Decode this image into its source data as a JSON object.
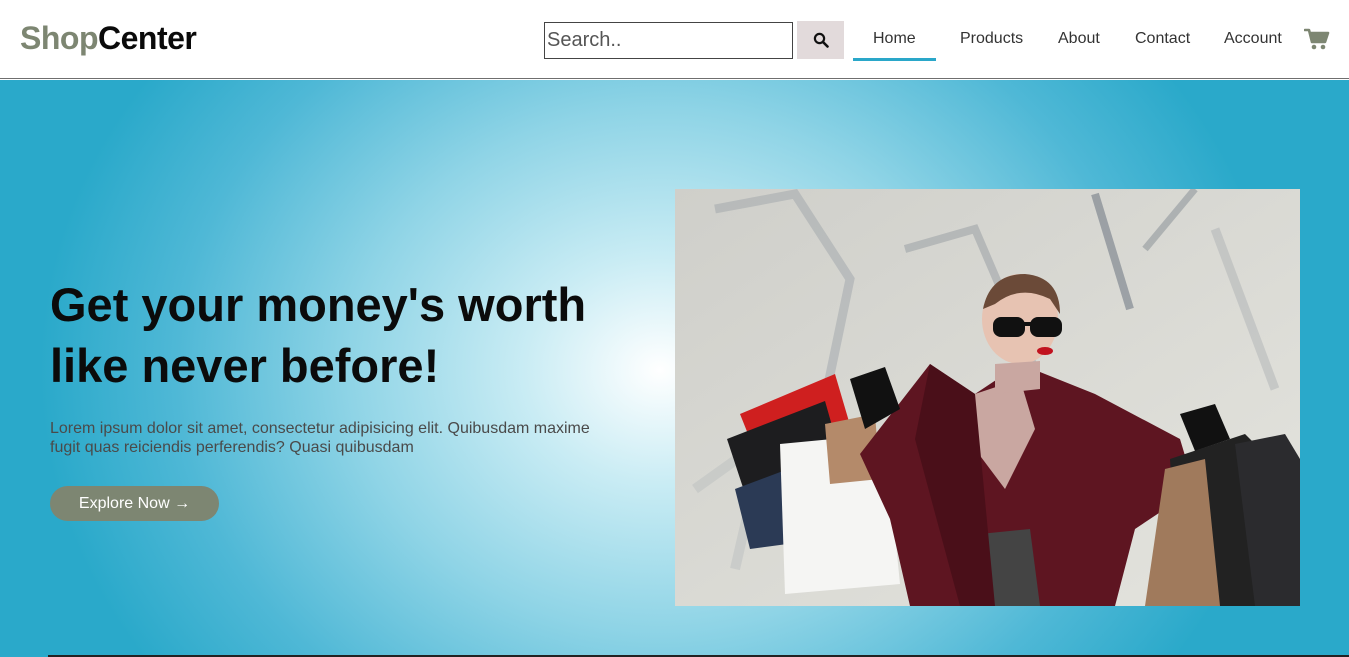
{
  "header": {
    "logo": {
      "part1": "Shop",
      "part2": "Center"
    },
    "search": {
      "placeholder": "Search.."
    },
    "nav": {
      "home": "Home",
      "products": "Products",
      "about": "About",
      "contact": "Contact",
      "account": "Account"
    },
    "icons": {
      "search": "search-icon",
      "cart": "cart-icon"
    }
  },
  "hero": {
    "title": "Get your money's worth like never before!",
    "description": "Lorem ipsum dolor sit amet, consectetur adipisicing elit. Quibusdam maxime fugit quas reiciendis perferendis? Quasi quibusdam",
    "cta_label": "Explore Now →"
  },
  "colors": {
    "accent": "#2aa7c9",
    "brand": "#7d8672",
    "search_button": "#e2dadb"
  }
}
